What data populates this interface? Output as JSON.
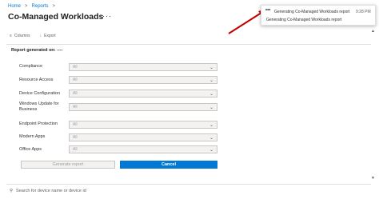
{
  "breadcrumb": {
    "home": "Home",
    "separator": ">",
    "reports": "Reports",
    "trail_end": ">"
  },
  "page": {
    "title": "Co-Managed Workloads",
    "more": "···"
  },
  "toolbar": {
    "columns_icon": "≡",
    "columns": "Columns",
    "export_icon": "↓",
    "export": "Export"
  },
  "report": {
    "generated_on": "Report generated on: ----"
  },
  "filters": [
    {
      "label": "Compliance",
      "value": "All"
    },
    {
      "label": "Resource Access",
      "value": "All"
    },
    {
      "label": "Device Configuration",
      "value": "All"
    },
    {
      "label": "Windows Update for Business",
      "value": "All"
    },
    {
      "label": "Endpoint Protection",
      "value": "All"
    },
    {
      "label": "Modern Apps",
      "value": "All"
    },
    {
      "label": "Office Apps",
      "value": "All"
    }
  ],
  "chevron": "⌄",
  "buttons": {
    "generate": "Generate report",
    "cancel": "Cancel"
  },
  "search": {
    "icon": "⚲",
    "placeholder": "Search for device name or device id"
  },
  "scroll": {
    "up": "▲",
    "down": "▼"
  },
  "toast": {
    "dots": "•••",
    "title": "Generating Co-Managed Workloads report",
    "time": "9:28 PM",
    "message": "Generating Co-Managed Workloads report"
  },
  "colors": {
    "accent": "#0078d4",
    "arrow": "#c00000"
  }
}
